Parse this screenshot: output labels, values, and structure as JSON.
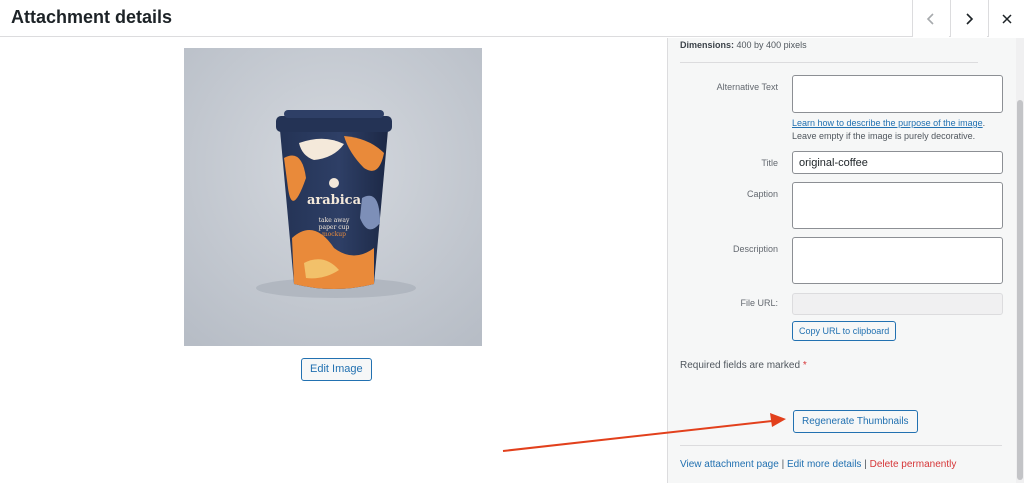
{
  "header": {
    "title": "Attachment details",
    "prev_icon": "chevron-left-icon",
    "next_icon": "chevron-right-icon",
    "close_icon": "close-icon"
  },
  "preview": {
    "brand_text": "arabica",
    "sub_text": "take away",
    "sub_text2": "paper cup",
    "sub_text3": "mockup",
    "edit_label": "Edit Image"
  },
  "details": {
    "dimensions_label": "Dimensions:",
    "dimensions_value": "400 by 400 pixels"
  },
  "fields": {
    "alt_label": "Alternative Text",
    "alt_value": "",
    "help_link": "Learn how to describe the purpose of the image",
    "help_after": ".",
    "help_note": "Leave empty if the image is purely decorative.",
    "title_label": "Title",
    "title_value": "original-coffee",
    "caption_label": "Caption",
    "caption_value": "",
    "description_label": "Description",
    "description_value": "",
    "url_label": "File URL:",
    "url_value": "",
    "copy_label": "Copy URL to clipboard"
  },
  "required": {
    "text": "Required fields are marked",
    "star": "*"
  },
  "regenerate_label": "Regenerate Thumbnails",
  "actions": {
    "view": "View attachment page",
    "sep1": "|",
    "edit": "Edit more details",
    "sep2": "|",
    "delete": "Delete permanently"
  },
  "colors": {
    "accent": "#2271b1",
    "danger": "#d63638",
    "annotation_arrow": "#e2401c"
  }
}
